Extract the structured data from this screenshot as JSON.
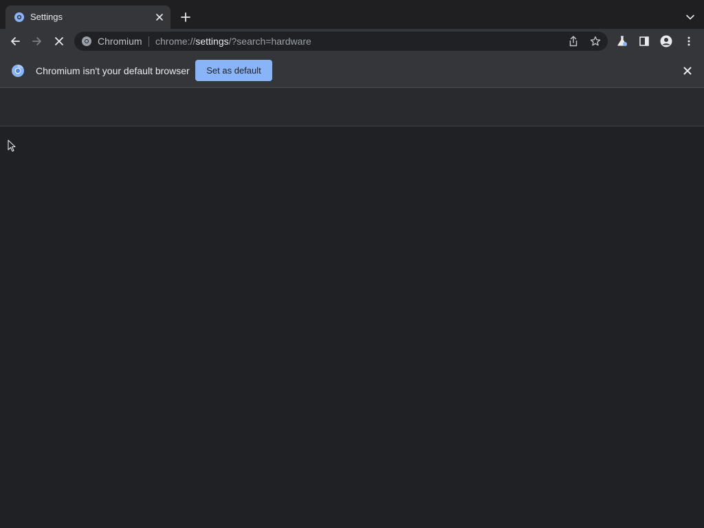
{
  "window": {
    "tab_title": "Settings"
  },
  "omnibox": {
    "site_name": "Chromium",
    "url_scheme": "chrome://",
    "url_host": "settings",
    "url_path": "/?search=hardware"
  },
  "infobar": {
    "message": "Chromium isn't your default browser",
    "button_label": "Set as default"
  },
  "colors": {
    "accent": "#8ab4f8",
    "background": "#202124",
    "toolbar": "#35363a"
  },
  "icons": [
    "settings-favicon",
    "close-icon",
    "plus-icon",
    "chevron-down-icon",
    "back-arrow-icon",
    "forward-arrow-icon",
    "stop-icon",
    "chromium-icon",
    "share-icon",
    "star-icon",
    "labs-flask-icon",
    "side-panel-icon",
    "profile-icon",
    "kebab-menu-icon",
    "chromium-logo-icon",
    "mouse-cursor-icon"
  ]
}
